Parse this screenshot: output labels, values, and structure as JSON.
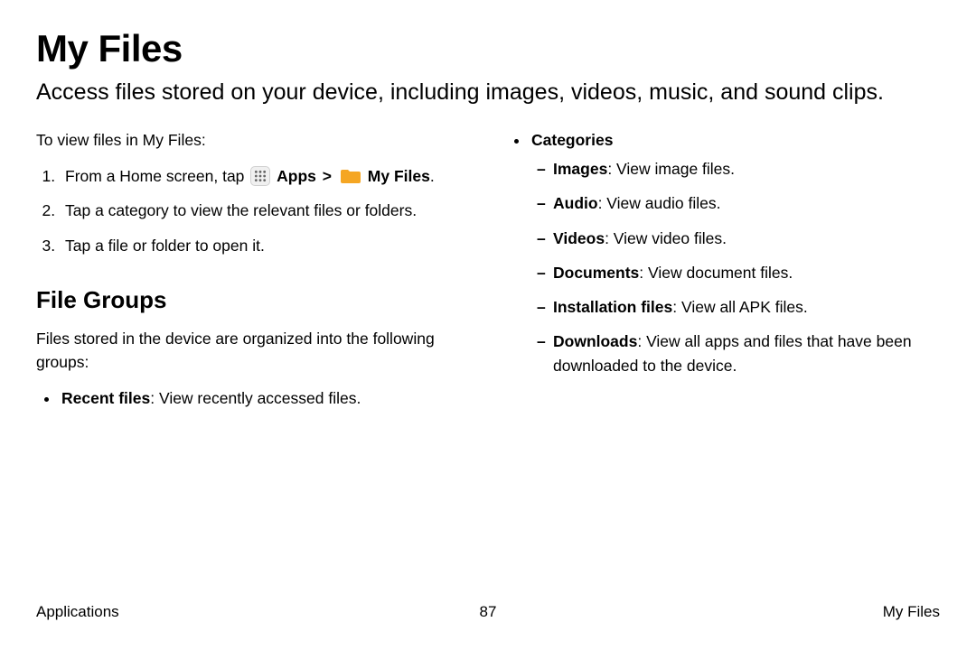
{
  "title": "My Files",
  "subtitle": "Access files stored on your device, including images, videos, music, and sound clips.",
  "left": {
    "intro": "To view files in My Files:",
    "step1_prefix": "From a Home screen, tap ",
    "apps_label": "Apps",
    "chevron": ">",
    "myfiles_label": "My Files",
    "step1_suffix": ".",
    "step2": "Tap a category to view the relevant files or folders.",
    "step3": "Tap a file or folder to open it.",
    "h2": "File Groups",
    "para": "Files stored in the device are organized into the following groups:",
    "recent_bold": "Recent files",
    "recent_rest": ": View recently accessed files."
  },
  "right": {
    "categories_label": "Categories",
    "items": {
      "images_bold": "Images",
      "images_rest": ": View image files.",
      "audio_bold": "Audio",
      "audio_rest": ": View audio files.",
      "videos_bold": "Videos",
      "videos_rest": ": View video files.",
      "documents_bold": "Documents",
      "documents_rest": ": View document files.",
      "install_bold": "Installation files",
      "install_rest": ": View all APK files.",
      "downloads_bold": "Downloads",
      "downloads_rest": ": View all apps and files that have been downloaded to the device."
    }
  },
  "footer": {
    "left": "Applications",
    "center": "87",
    "right": "My Files"
  }
}
